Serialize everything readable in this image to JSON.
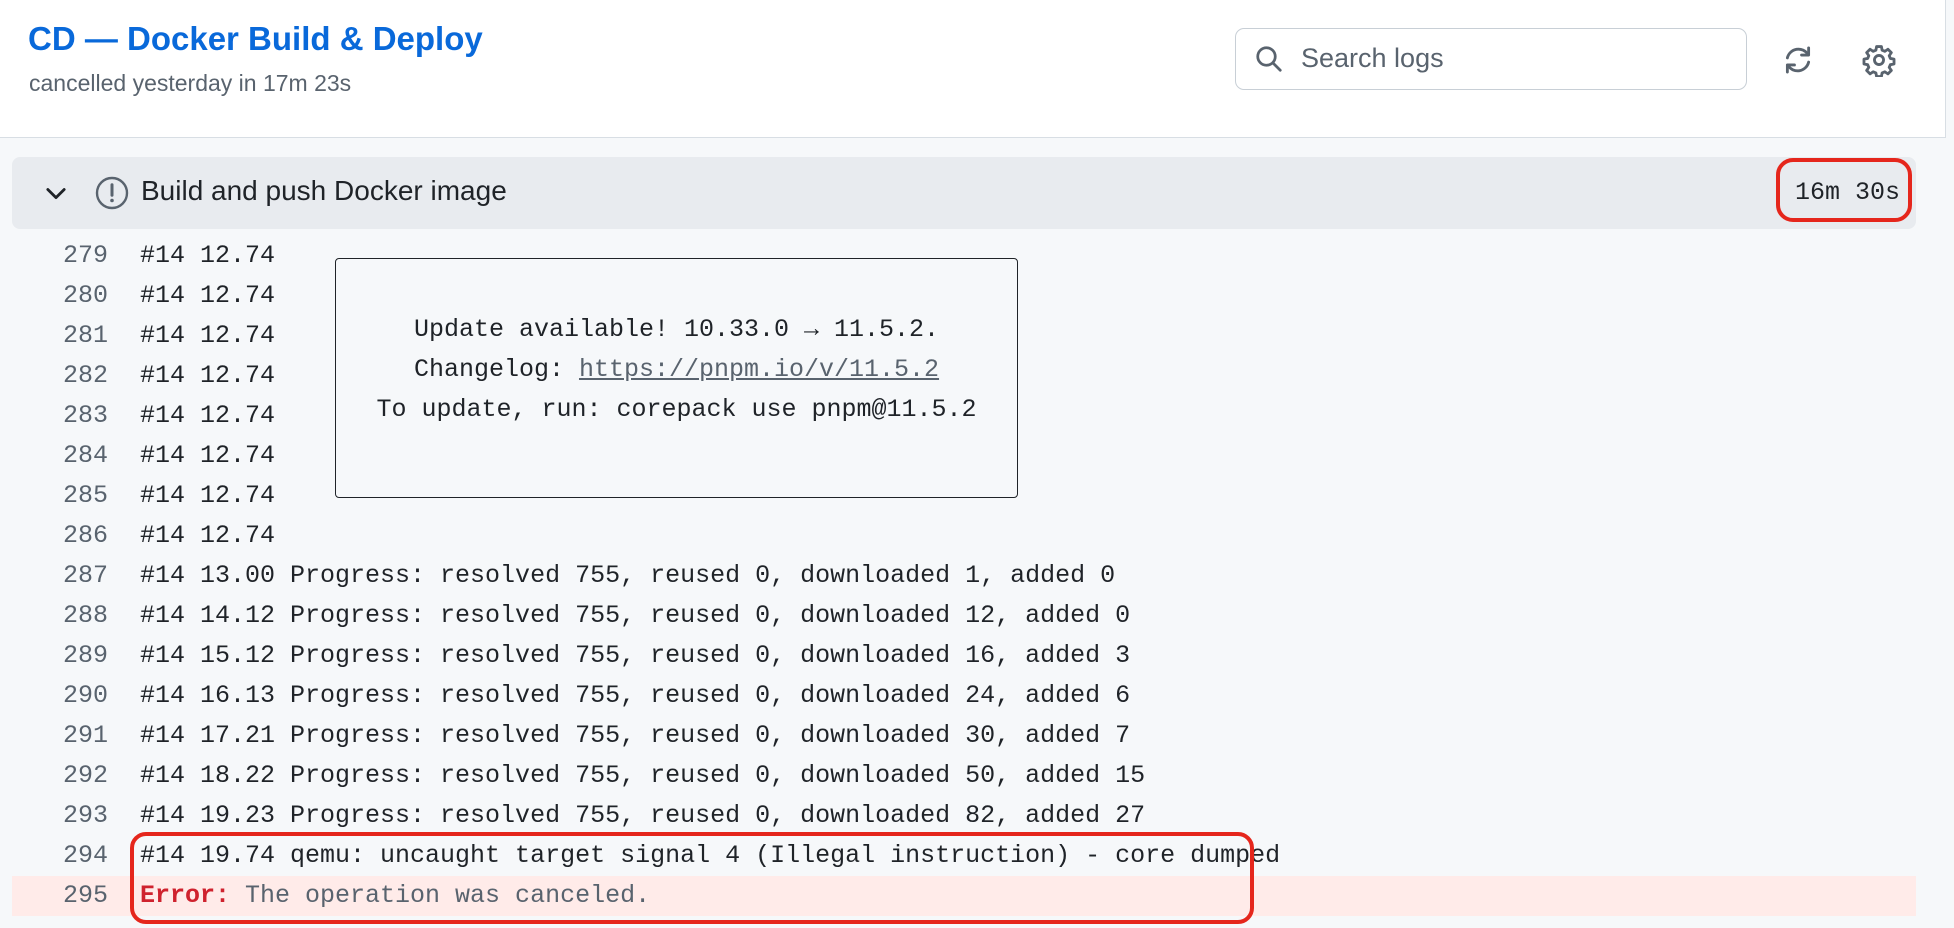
{
  "header": {
    "title": "CD — Docker Build & Deploy",
    "subtitle": "cancelled yesterday in 17m 23s",
    "search": {
      "placeholder": "Search logs",
      "value": ""
    },
    "icons": {
      "search": "search-icon",
      "refresh": "refresh-icon",
      "settings": "gear-icon"
    }
  },
  "step": {
    "title": "Build and push Docker image",
    "duration": "16m 30s",
    "status": "cancelled",
    "icons": {
      "chevron": "chevron-down-icon",
      "status": "alert-circle-icon"
    }
  },
  "update_notice": {
    "line1": "Update available! 10.33.0 → 11.5.2.",
    "line2_prefix": "Changelog: ",
    "line2_link": "https://pnpm.io/v/11.5.2",
    "line3": "To update, run: corepack use pnpm@11.5.2"
  },
  "log": {
    "lines": [
      {
        "num": "279",
        "text": "#14 12.74"
      },
      {
        "num": "280",
        "text": "#14 12.74"
      },
      {
        "num": "281",
        "text": "#14 12.74"
      },
      {
        "num": "282",
        "text": "#14 12.74"
      },
      {
        "num": "283",
        "text": "#14 12.74"
      },
      {
        "num": "284",
        "text": "#14 12.74"
      },
      {
        "num": "285",
        "text": "#14 12.74"
      },
      {
        "num": "286",
        "text": "#14 12.74"
      },
      {
        "num": "287",
        "text": "#14 13.00 Progress: resolved 755, reused 0, downloaded 1, added 0"
      },
      {
        "num": "288",
        "text": "#14 14.12 Progress: resolved 755, reused 0, downloaded 12, added 0"
      },
      {
        "num": "289",
        "text": "#14 15.12 Progress: resolved 755, reused 0, downloaded 16, added 3"
      },
      {
        "num": "290",
        "text": "#14 16.13 Progress: resolved 755, reused 0, downloaded 24, added 6"
      },
      {
        "num": "291",
        "text": "#14 17.21 Progress: resolved 755, reused 0, downloaded 30, added 7"
      },
      {
        "num": "292",
        "text": "#14 18.22 Progress: resolved 755, reused 0, downloaded 50, added 15"
      },
      {
        "num": "293",
        "text": "#14 19.23 Progress: resolved 755, reused 0, downloaded 82, added 27"
      },
      {
        "num": "294",
        "text": "#14 19.74 qemu: uncaught target signal 4 (Illegal instruction) - core dumped"
      }
    ],
    "error_line": {
      "num": "295",
      "label": "Error:",
      "message": " The operation was canceled."
    }
  },
  "colors": {
    "accent": "#0969da",
    "error": "#cf222e",
    "error_bg": "#ffebe9",
    "highlight": "#e5261c"
  }
}
